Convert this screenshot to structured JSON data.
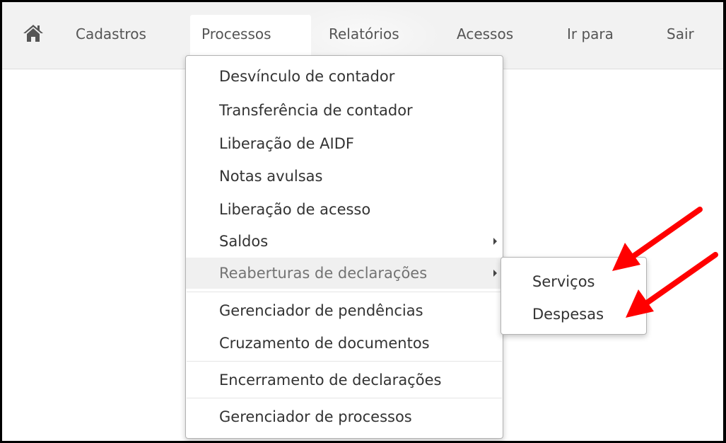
{
  "nav": {
    "home_icon": "home-icon",
    "items": [
      {
        "label": "Cadastros"
      },
      {
        "label": "Processos"
      },
      {
        "label": "Relatórios"
      },
      {
        "label": "Acessos"
      },
      {
        "label": "Ir para"
      },
      {
        "label": "Sair"
      }
    ],
    "active": "Processos"
  },
  "dropdown": {
    "items": [
      {
        "label": "Desvínculo de contador"
      },
      {
        "label": "Transferência de contador"
      },
      {
        "label": "Liberação de AIDF"
      },
      {
        "label": "Notas avulsas"
      },
      {
        "label": "Liberação de acesso"
      },
      {
        "label": "Saldos",
        "has_submenu": true
      },
      {
        "label": "Reaberturas de declarações",
        "has_submenu": true,
        "highlighted": true
      },
      {
        "label": "Gerenciador de pendências"
      },
      {
        "label": "Cruzamento de documentos"
      },
      {
        "label": "Encerramento de declarações"
      },
      {
        "label": "Gerenciador de processos"
      }
    ]
  },
  "submenu": {
    "items": [
      {
        "label": "Serviços"
      },
      {
        "label": "Despesas"
      }
    ]
  },
  "annotation": {
    "arrow_color": "#ff0000",
    "arrow_count": 2
  }
}
